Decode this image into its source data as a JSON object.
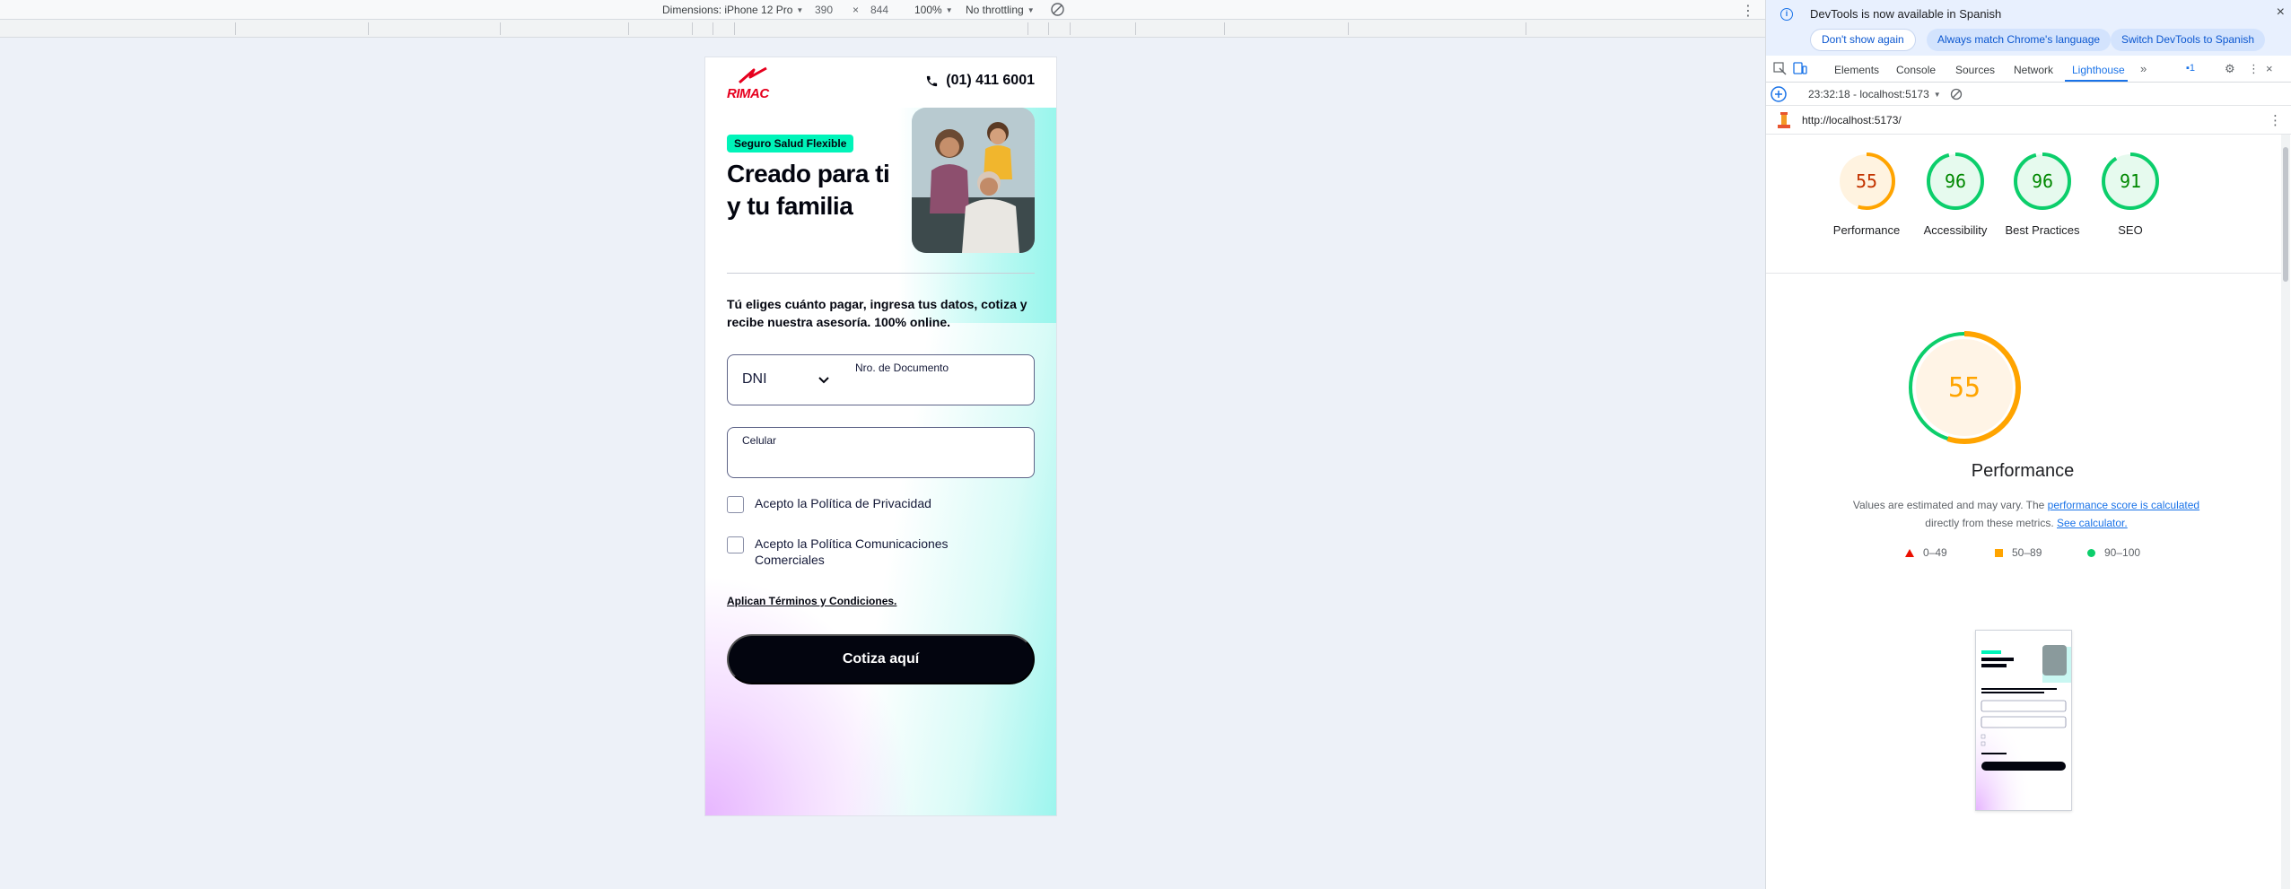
{
  "toolbar": {
    "dimensions_label": "Dimensions: iPhone 12 Pro",
    "width": "390",
    "times": "×",
    "height": "844",
    "zoom": "100%",
    "throttling": "No throttling"
  },
  "page": {
    "logo_text": "RIMAC",
    "phone": "(01) 411 6001",
    "badge": "Seguro Salud Flexible",
    "hero_title": "Creado para ti y tu familia",
    "intro": "Tú eliges cuánto pagar, ingresa tus datos, cotiza y recibe nuestra asesoría. 100% online.",
    "doc_type": "DNI",
    "doc_label": "Nro. de Documento",
    "doc_value": "",
    "cel_label": "Celular",
    "cel_value": "",
    "privacy": "Acepto la Política de Privacidad",
    "comms": "Acepto la Política Comunicaciones Comerciales",
    "terms": "Aplican Términos y Condiciones.",
    "cta": "Cotiza aquí"
  },
  "devtools": {
    "info_message": "DevTools is now available in Spanish",
    "btn_dont_show": "Don't show again",
    "btn_always_match": "Always match Chrome's language",
    "btn_switch": "Switch DevTools to Spanish",
    "tabs": [
      "Elements",
      "Console",
      "Sources",
      "Network",
      "Lighthouse"
    ],
    "active_tab": "Lighthouse",
    "issues_count": "1",
    "report_time": "23:32:18 - localhost:5173",
    "url": "http://localhost:5173/"
  },
  "lighthouse": {
    "scores": [
      {
        "name": "Performance",
        "value": 55,
        "color": "#ffa400"
      },
      {
        "name": "Accessibility",
        "value": 96,
        "color": "#0cce6b"
      },
      {
        "name": "Best Practices",
        "value": 96,
        "color": "#0cce6b"
      },
      {
        "name": "SEO",
        "value": 91,
        "color": "#0cce6b"
      }
    ],
    "perf_title": "Performance",
    "note_a": "Values are estimated and may vary. The ",
    "note_link1": "performance score is calculated",
    "note_b": "directly from these metrics.",
    "note_link2": "See calculator.",
    "legend": [
      {
        "range": "0–49",
        "color": "#eb0f00"
      },
      {
        "range": "50–89",
        "color": "#ffa400"
      },
      {
        "range": "90–100",
        "color": "#0cce6b"
      }
    ]
  }
}
